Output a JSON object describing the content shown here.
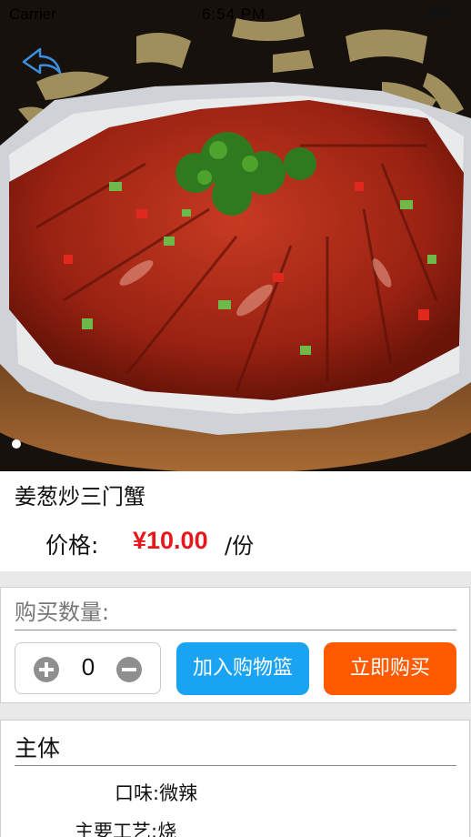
{
  "status_bar": {
    "carrier": "Carrier",
    "time": "6:54 PM"
  },
  "navigation": {
    "back_icon": "back-arrow-icon"
  },
  "banner": {
    "image_subject": "dish-photo",
    "active_page": 1
  },
  "dish": {
    "name": "姜葱炒三门蟹",
    "price_label": "价格:",
    "price": "¥10.00",
    "unit": "/份"
  },
  "purchase": {
    "quantity_label": "购买数量:",
    "quantity": "0",
    "plus_icon": "plus-circle-icon",
    "minus_icon": "minus-circle-icon",
    "add_to_cart_label": "加入购物篮",
    "buy_now_label": "立即购买"
  },
  "details": {
    "section_title": "主体",
    "rows": [
      {
        "label": "口味:",
        "value": "微辣"
      },
      {
        "label": "主要工艺:",
        "value": "烧"
      }
    ]
  },
  "colors": {
    "price": "#e8171c",
    "cart_button": "#1aa3f3",
    "buy_button": "#ff5a00",
    "back_arrow": "#3b8fe0"
  }
}
